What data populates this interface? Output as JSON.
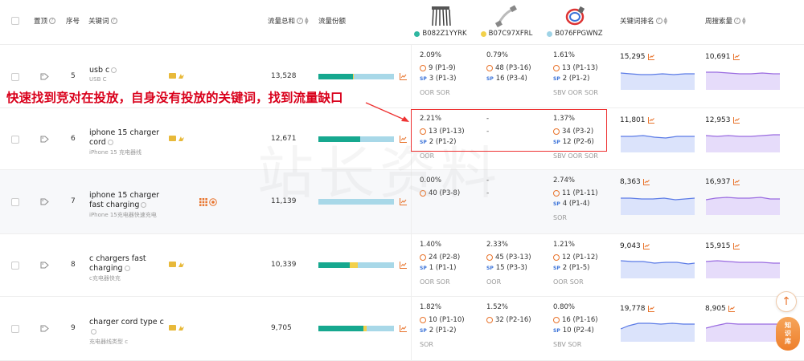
{
  "header": {
    "pin": "置顶",
    "index": "序号",
    "keyword": "关键词",
    "traffic_total": "流量总和",
    "traffic_share": "流量份额",
    "kw_rank": "关键词排名",
    "weekly_search": "周搜索量"
  },
  "asins": [
    {
      "code": "B082Z1YYRK",
      "color": "#2fb7a1"
    },
    {
      "code": "B07C97XFRL",
      "color": "#f2d14b"
    },
    {
      "code": "B076FPGWNZ",
      "color": "#9fd3e6"
    }
  ],
  "colors": {
    "accent": "#e8732b",
    "sp": "#3a72d8",
    "teal": "#16a88f",
    "annotation": "#d9001b"
  },
  "annotation": {
    "text": "快速找到竞对在投放，自身没有投放的关键词，找到流量缺口"
  },
  "watermark": "站长资料",
  "rows": [
    {
      "index": "5",
      "keyword": "usb c",
      "keyword_sub": "USB C",
      "traffic": "13,528",
      "share": [
        0.46,
        0.01,
        0.53
      ],
      "a1": {
        "pct": "2.09%",
        "organic": "9 (P1-9)",
        "sp": "3 (P1-3)",
        "flag": "OOR SOR"
      },
      "a2": {
        "pct": "0.79%",
        "organic": "48 (P3-16)",
        "sp": "16 (P3-4)",
        "flag": ""
      },
      "a3": {
        "pct": "1.61%",
        "organic": "13 (P1-13)",
        "sp": "2 (P1-2)",
        "flag": "SBV OOR SOR"
      },
      "rank": "15,295",
      "weekly": "10,691"
    },
    {
      "index": "6",
      "keyword": "iphone 15 charger cord",
      "keyword_sub": "iPhone 15 充电器线",
      "traffic": "12,671",
      "share": [
        0.55,
        0.0,
        0.45
      ],
      "a1": {
        "pct": "2.21%",
        "organic": "13 (P1-13)",
        "sp": "2 (P1-2)",
        "flag": "OOR"
      },
      "a2": {
        "pct": "-",
        "organic": "-",
        "sp": "",
        "flag": ""
      },
      "a3": {
        "pct": "1.37%",
        "organic": "34 (P3-2)",
        "sp": "12 (P2-6)",
        "flag": "SBV OOR SOR"
      },
      "rank": "11,801",
      "weekly": "12,953"
    },
    {
      "index": "7",
      "keyword": "iphone 15 charger fast charging",
      "keyword_sub": "iPhone 15充电器快速充电",
      "traffic": "11,139",
      "share": [
        0.0,
        0.0,
        1.0
      ],
      "a1": {
        "pct": "0.00%",
        "organic": "40 (P3-8)",
        "sp": "",
        "flag": ""
      },
      "a2": {
        "pct": "-",
        "organic": "-",
        "sp": "",
        "flag": ""
      },
      "a3": {
        "pct": "2.74%",
        "organic": "11 (P1-11)",
        "sp": "4 (P1-4)",
        "flag": "SOR"
      },
      "rank": "8,363",
      "weekly": "16,937"
    },
    {
      "index": "8",
      "keyword": "c chargers fast charging",
      "keyword_sub": "c充电器快充",
      "traffic": "10,339",
      "share": [
        0.42,
        0.1,
        0.48
      ],
      "a1": {
        "pct": "1.40%",
        "organic": "24 (P2-8)",
        "sp": "1 (P1-1)",
        "flag": "OOR SOR"
      },
      "a2": {
        "pct": "2.33%",
        "organic": "45 (P3-13)",
        "sp": "15 (P3-3)",
        "flag": "OOR"
      },
      "a3": {
        "pct": "1.21%",
        "organic": "12 (P1-12)",
        "sp": "2 (P1-5)",
        "flag": "OOR SOR"
      },
      "rank": "9,043",
      "weekly": "15,915"
    },
    {
      "index": "9",
      "keyword": "charger cord type c",
      "keyword_sub": "充电器线类型 c",
      "traffic": "9,705",
      "share": [
        0.6,
        0.04,
        0.36
      ],
      "a1": {
        "pct": "1.82%",
        "organic": "10 (P1-10)",
        "sp": "2 (P1-2)",
        "flag": "SOR"
      },
      "a2": {
        "pct": "1.52%",
        "organic": "32 (P2-16)",
        "sp": "",
        "flag": ""
      },
      "a3": {
        "pct": "0.80%",
        "organic": "16 (P1-16)",
        "sp": "10 (P2-4)",
        "flag": "SBV SOR"
      },
      "rank": "19,778",
      "weekly": "8,905"
    }
  ],
  "labels": {
    "sp": "SP",
    "top": "↑",
    "kb1": "知",
    "kb2": "识",
    "kb3": "库"
  }
}
